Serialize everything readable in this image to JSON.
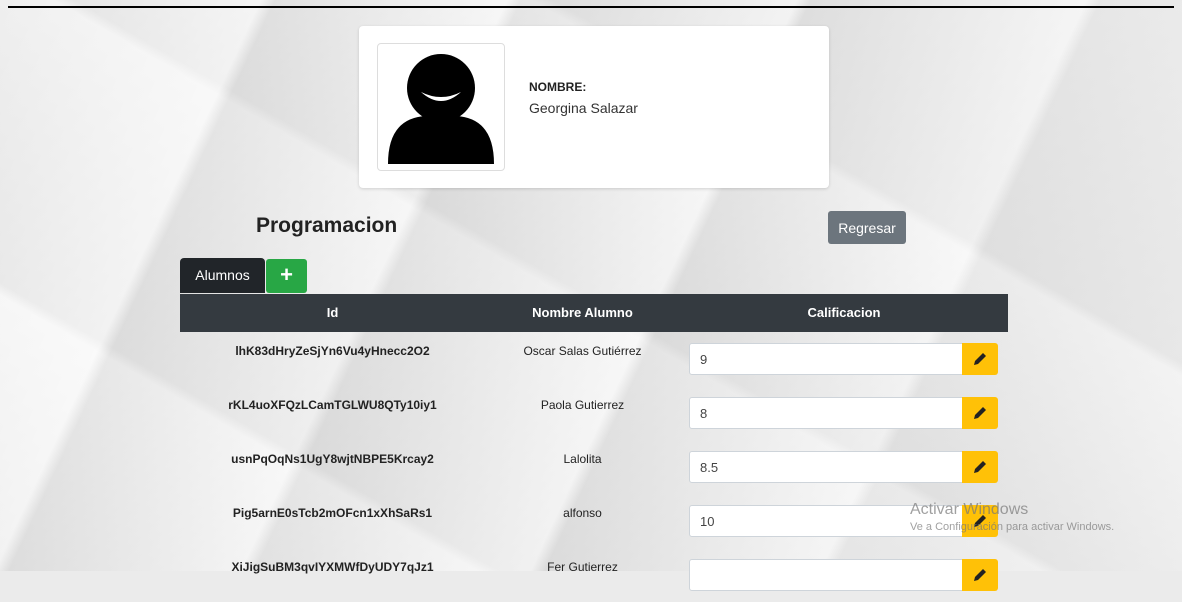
{
  "profile": {
    "name_label": "NOMBRE:",
    "name_value": "Georgina Salazar",
    "avatar_icon": "user-avatar-icon"
  },
  "section": {
    "title": "Programacion",
    "back_label": "Regresar"
  },
  "tabs": {
    "alumnos_label": "Alumnos",
    "add_label": "+"
  },
  "table": {
    "headers": {
      "id": "Id",
      "name": "Nombre Alumno",
      "grade": "Calificacion"
    },
    "rows": [
      {
        "id": "lhK83dHryZeSjYn6Vu4yHnecc2O2",
        "name": "Oscar Salas Gutiérrez",
        "grade": "9"
      },
      {
        "id": "rKL4uoXFQzLCamTGLWU8QTy10iy1",
        "name": "Paola Gutierrez",
        "grade": "8"
      },
      {
        "id": "usnPqOqNs1UgY8wjtNBPE5Krcay2",
        "name": "Lalolita",
        "grade": "8.5"
      },
      {
        "id": "Pig5arnE0sTcb2mOFcn1xXhSaRs1",
        "name": "alfonso",
        "grade": "10"
      },
      {
        "id": "XiJigSuBM3qvIYXMWfDyUDY7qJz1",
        "name": "Fer Gutierrez",
        "grade": ""
      }
    ]
  },
  "watermark": {
    "title": "Activar Windows",
    "subtitle": "Ve a Configuración para activar Windows."
  },
  "colors": {
    "header_bg": "#343a40",
    "add_green": "#28a745",
    "edit_yellow": "#ffc107",
    "back_gray": "#6c757d"
  }
}
